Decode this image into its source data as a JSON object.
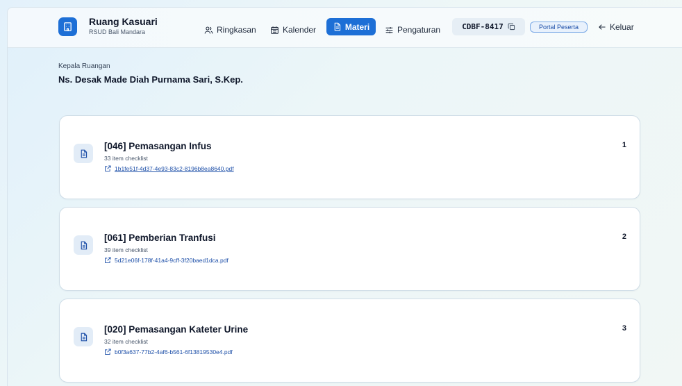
{
  "brand": {
    "title": "Ruang Kasuari",
    "subtitle": "RSUD Bali Mandara",
    "icon": "building-icon"
  },
  "nav": {
    "items": [
      {
        "label": "Ringkasan",
        "icon": "users-icon"
      },
      {
        "label": "Kalender",
        "icon": "calendar-icon"
      },
      {
        "label": "Materi",
        "icon": "document-icon",
        "active": true
      },
      {
        "label": "Pengaturan",
        "icon": "sliders-icon"
      }
    ],
    "code": "CDBF-8417",
    "code_icon": "copy-icon",
    "portal_label": "Portal Peserta",
    "logout_label": "Keluar",
    "logout_icon": "arrow-left-icon"
  },
  "head": {
    "label": "Kepala Ruangan",
    "name": "Ns. Desak Made Diah Purnama Sari, S.Kep."
  },
  "materials": [
    {
      "title": "[046] Pemasangan Infus",
      "count": "33 item checklist",
      "file": "1b1fe51f-4d37-4e93-83c2-8196b8ea8640.pdf",
      "number": "1",
      "underlined": true
    },
    {
      "title": "[061] Pemberian Tranfusi",
      "count": "39 item checklist",
      "file": "5d21e06f-178f-41a4-9cff-3f20baed1dca.pdf",
      "number": "2",
      "underlined": false
    },
    {
      "title": "[020] Pemasangan Kateter Urine",
      "count": "32 item checklist",
      "file": "b0f3a637-77b2-4af6-b561-6f13819530e4.pdf",
      "number": "3",
      "underlined": false
    }
  ],
  "colors": {
    "accent": "#1d6fd6",
    "link": "#1d4fa8",
    "icon_bg": "#e2ecf7"
  }
}
